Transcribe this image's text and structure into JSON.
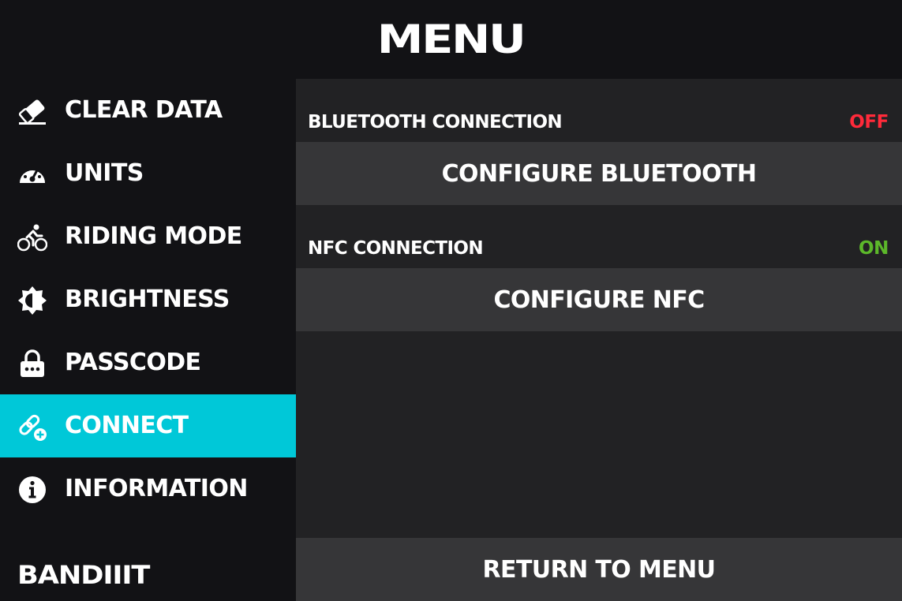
{
  "header": {
    "title": "MENU"
  },
  "sidebar": {
    "items": [
      {
        "label": "CLEAR DATA",
        "icon": "eraser-icon"
      },
      {
        "label": "UNITS",
        "icon": "speedometer-icon"
      },
      {
        "label": "RIDING MODE",
        "icon": "cyclist-icon"
      },
      {
        "label": "BRIGHTNESS",
        "icon": "brightness-icon"
      },
      {
        "label": "PASSCODE",
        "icon": "lock-icon"
      },
      {
        "label": "CONNECT",
        "icon": "link-add-icon",
        "active": true
      },
      {
        "label": "INFORMATION",
        "icon": "info-icon"
      }
    ],
    "logo": "BANDIIIT"
  },
  "connect": {
    "bluetooth": {
      "label": "BLUETOOTH CONNECTION",
      "status": "OFF",
      "status_color": "#ff2a3a",
      "button": "CONFIGURE BLUETOOTH"
    },
    "nfc": {
      "label": "NFC CONNECTION",
      "status": "ON",
      "status_color": "#5cb82a",
      "button": "CONFIGURE NFC"
    }
  },
  "footer": {
    "return_label": "RETURN TO MENU"
  },
  "colors": {
    "accent": "#00c8d8",
    "background": "#121215",
    "panel": "#222224",
    "button": "#363638"
  }
}
